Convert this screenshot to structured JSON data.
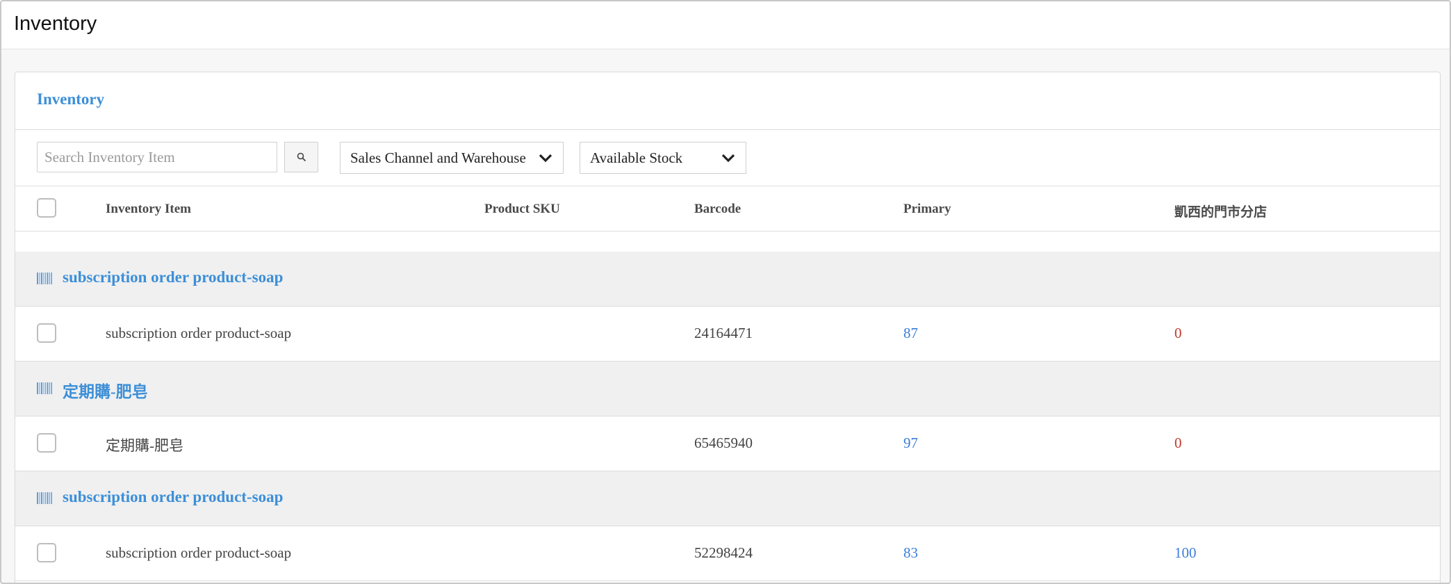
{
  "page": {
    "title": "Inventory"
  },
  "panel": {
    "title": "Inventory"
  },
  "toolbar": {
    "search_placeholder": "Search Inventory Item",
    "channel_select": "Sales Channel and Warehouse",
    "stock_select": "Available Stock"
  },
  "columns": {
    "item": "Inventory Item",
    "sku": "Product SKU",
    "barcode": "Barcode",
    "primary": "Primary",
    "store": "凱西的門市分店"
  },
  "groups": [
    {
      "name": "subscription order product-soap",
      "item": {
        "name": "subscription order product-soap",
        "sku": "",
        "barcode": "24164471",
        "primary": "87",
        "store": "0",
        "store_color": "#c0392b"
      }
    },
    {
      "name": "定期購-肥皂",
      "item": {
        "name": "定期購-肥皂",
        "sku": "",
        "barcode": "65465940",
        "primary": "97",
        "store": "0",
        "store_color": "#c0392b"
      }
    },
    {
      "name": "subscription order product-soap",
      "item": {
        "name": "subscription order product-soap",
        "sku": "",
        "barcode": "52298424",
        "primary": "83",
        "store": "100",
        "store_color": "#3b7dd8"
      }
    }
  ],
  "icons": {
    "group": "barcode-icon",
    "search": "search-icon",
    "dropdown": "chevron-down-icon"
  },
  "colors": {
    "accent": "#3d8fd8",
    "link": "#3b7dd8",
    "zero": "#c0392b"
  }
}
